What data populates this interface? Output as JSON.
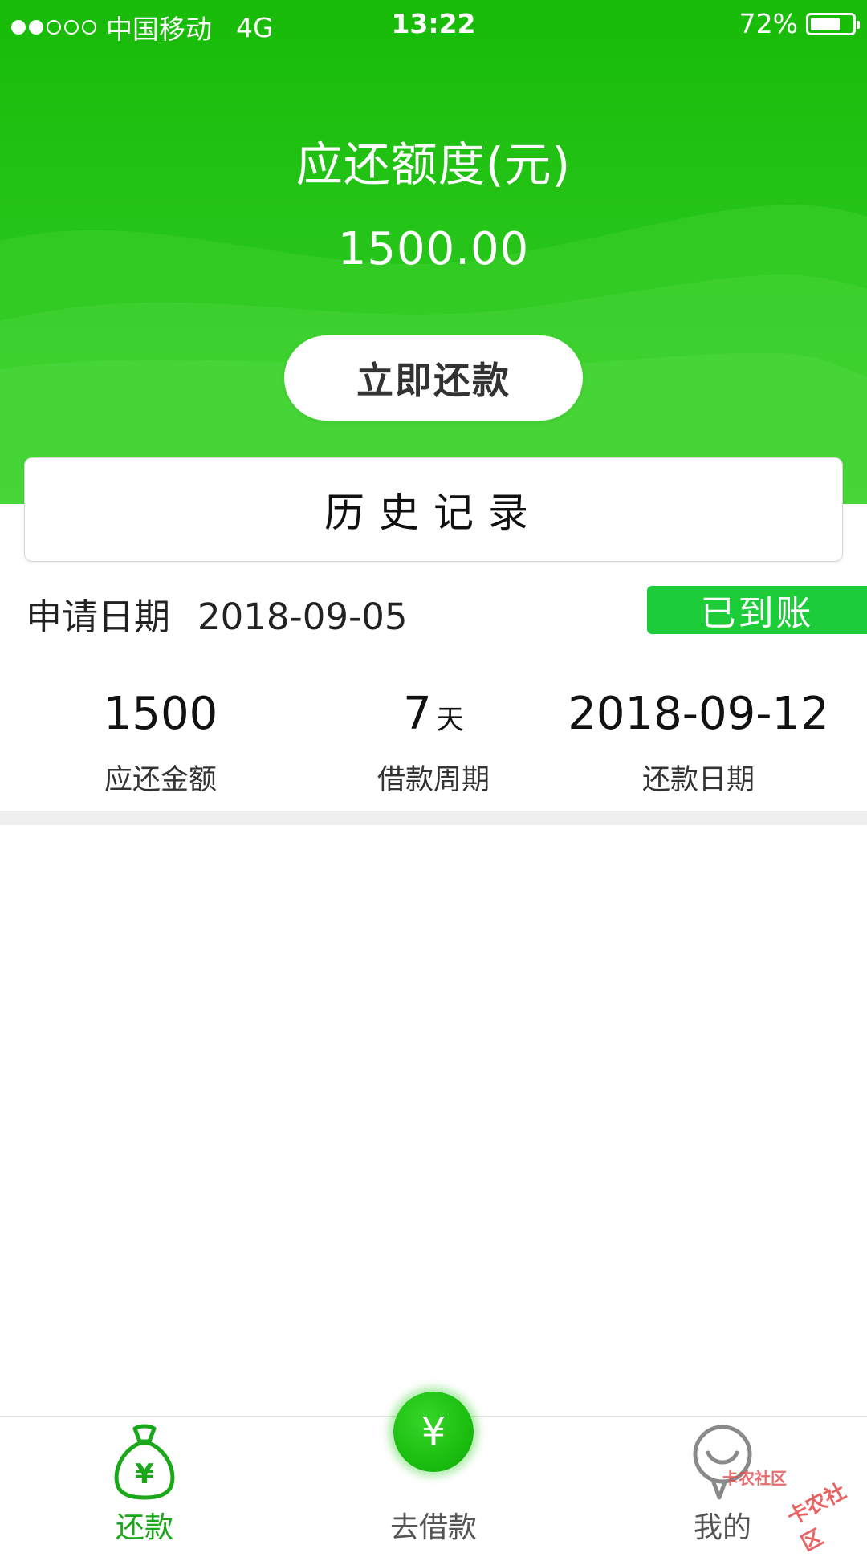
{
  "status_bar": {
    "signal_dots": [
      true,
      true,
      false,
      false,
      false
    ],
    "carrier": "中国移动",
    "network": "4G",
    "time": "13:22",
    "battery_text": "72%",
    "battery_level": 0.72
  },
  "hero": {
    "title": "应还额度(元)",
    "amount": "1500.00",
    "repay_button": "立即还款"
  },
  "history": {
    "title": "历史记录"
  },
  "record": {
    "apply_date_label": "申请日期",
    "apply_date": "2018-09-05",
    "status": "已到账",
    "stats": [
      {
        "value": "1500",
        "unit": "",
        "label": "应还金额"
      },
      {
        "value": "7",
        "unit": "天",
        "label": "借款周期"
      },
      {
        "value": "2018-09-12",
        "unit": "",
        "label": "还款日期"
      }
    ]
  },
  "tabs": {
    "repay": "还款",
    "borrow": "去借款",
    "mine": "我的",
    "yen_symbol": "¥"
  },
  "watermark": {
    "text": "卡农社区"
  },
  "colors": {
    "brand_green": "#1dc011",
    "badge_green": "#1ccc38",
    "tab_active": "#1aa81a"
  }
}
